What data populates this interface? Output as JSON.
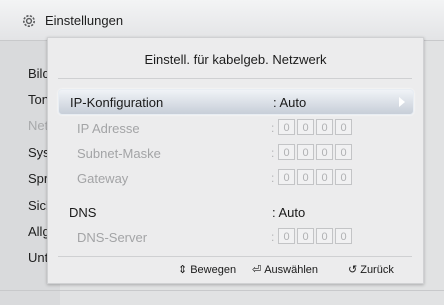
{
  "app": {
    "title": "Einstellungen",
    "icon": "gear-icon"
  },
  "sidebar": {
    "items": [
      {
        "label": "Bild",
        "dim": false
      },
      {
        "label": "Ton",
        "dim": false
      },
      {
        "label": "Netzwerk",
        "dim": true
      },
      {
        "label": "System",
        "dim": false
      },
      {
        "label": "Sprache",
        "dim": false
      },
      {
        "label": "Sicherheit",
        "dim": false
      },
      {
        "label": "Allgemein",
        "dim": false
      },
      {
        "label": "Unterstützung",
        "dim": false
      }
    ]
  },
  "dialog": {
    "title": "Einstell. für kabelgeb. Netzwerk",
    "ip_config": {
      "label": "IP-Konfiguration",
      "value": ": Auto"
    },
    "ip_address": {
      "label": "IP Adresse",
      "octets": [
        "0",
        "0",
        "0",
        "0"
      ]
    },
    "subnet": {
      "label": "Subnet-Maske",
      "octets": [
        "0",
        "0",
        "0",
        "0"
      ]
    },
    "gateway": {
      "label": "Gateway",
      "octets": [
        "0",
        "0",
        "0",
        "0"
      ]
    },
    "dns": {
      "label": "DNS",
      "value": ": Auto"
    },
    "dns_server": {
      "label": "DNS-Server",
      "octets": [
        "0",
        "0",
        "0",
        "0"
      ]
    },
    "colon": ":"
  },
  "footer": {
    "move": "Bewegen",
    "select": "Auswählen",
    "back": "Zurück",
    "move_icon": "⇕",
    "select_icon": "⏎",
    "back_icon": "↺"
  }
}
